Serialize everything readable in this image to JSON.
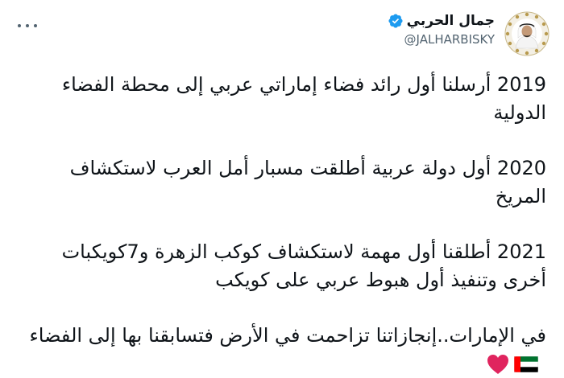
{
  "author": {
    "display_name": "جمال الحربي",
    "handle": "@JALHARBISKY",
    "verified": true
  },
  "tweet": {
    "paragraphs": [
      "2019 أرسلنا أول رائد فضاء إماراتي عربي إلى محطة الفضاء الدولية",
      "2020 أول دولة عربية أطلقت مسبار أمل العرب لاستكشاف المريخ",
      "2021 أطلقنا أول مهمة لاستكشاف كوكب الزهرة و7كويكبات أخرى وتنفيذ أول هبوط عربي على كويكب",
      "في الإمارات..إنجازاتنا تزاحمت في الأرض فتسابقنا بها إلى الفضاء"
    ],
    "emojis": [
      "flag-uae-icon",
      "red-heart-icon"
    ]
  },
  "colors": {
    "text": "#0f1419",
    "secondary": "#536471",
    "verified": "#1d9bf0",
    "heart": "#e0245e"
  }
}
